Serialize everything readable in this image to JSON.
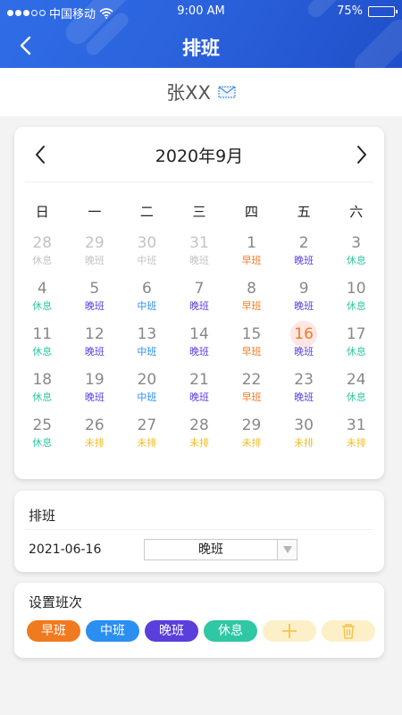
{
  "status": {
    "carrier": "中国移动",
    "time": "9:00 AM",
    "battery": "75%",
    "battery_level": 0.75
  },
  "nav": {
    "title": "排班"
  },
  "user": {
    "name": "张XX"
  },
  "calendar": {
    "month_label": "2020年9月",
    "weekdays": [
      "日",
      "一",
      "二",
      "三",
      "四",
      "五",
      "六"
    ],
    "days": [
      {
        "num": "28",
        "tag": "休息",
        "type": "rest",
        "other": true
      },
      {
        "num": "29",
        "tag": "晚班",
        "type": "night",
        "other": true
      },
      {
        "num": "30",
        "tag": "中班",
        "type": "mid",
        "other": true
      },
      {
        "num": "31",
        "tag": "晚班",
        "type": "night",
        "other": true
      },
      {
        "num": "1",
        "tag": "早班",
        "type": "early"
      },
      {
        "num": "2",
        "tag": "晚班",
        "type": "night"
      },
      {
        "num": "3",
        "tag": "休息",
        "type": "rest"
      },
      {
        "num": "4",
        "tag": "休息",
        "type": "rest"
      },
      {
        "num": "5",
        "tag": "晚班",
        "type": "night"
      },
      {
        "num": "6",
        "tag": "中班",
        "type": "mid"
      },
      {
        "num": "7",
        "tag": "晚班",
        "type": "night"
      },
      {
        "num": "8",
        "tag": "早班",
        "type": "early"
      },
      {
        "num": "9",
        "tag": "晚班",
        "type": "night"
      },
      {
        "num": "10",
        "tag": "休息",
        "type": "rest"
      },
      {
        "num": "11",
        "tag": "休息",
        "type": "rest"
      },
      {
        "num": "12",
        "tag": "晚班",
        "type": "night"
      },
      {
        "num": "13",
        "tag": "中班",
        "type": "mid"
      },
      {
        "num": "14",
        "tag": "晚班",
        "type": "night"
      },
      {
        "num": "15",
        "tag": "早班",
        "type": "early"
      },
      {
        "num": "16",
        "tag": "晚班",
        "type": "night",
        "selected": true
      },
      {
        "num": "17",
        "tag": "休息",
        "type": "rest"
      },
      {
        "num": "18",
        "tag": "休息",
        "type": "rest"
      },
      {
        "num": "19",
        "tag": "晚班",
        "type": "night"
      },
      {
        "num": "20",
        "tag": "中班",
        "type": "mid"
      },
      {
        "num": "21",
        "tag": "晚班",
        "type": "night"
      },
      {
        "num": "22",
        "tag": "早班",
        "type": "early"
      },
      {
        "num": "23",
        "tag": "晚班",
        "type": "night"
      },
      {
        "num": "24",
        "tag": "休息",
        "type": "rest"
      },
      {
        "num": "25",
        "tag": "休息",
        "type": "rest"
      },
      {
        "num": "26",
        "tag": "未排",
        "type": "none"
      },
      {
        "num": "27",
        "tag": "未排",
        "type": "none"
      },
      {
        "num": "28",
        "tag": "未排",
        "type": "none"
      },
      {
        "num": "29",
        "tag": "未排",
        "type": "none"
      },
      {
        "num": "30",
        "tag": "未排",
        "type": "none"
      },
      {
        "num": "31",
        "tag": "未排",
        "type": "none"
      }
    ]
  },
  "schedule": {
    "title": "排班",
    "date": "2021-06-16",
    "shift_value": "晚班"
  },
  "shift_settings": {
    "title": "设置班次",
    "chips": [
      {
        "label": "早班",
        "type": "early"
      },
      {
        "label": "中班",
        "type": "mid"
      },
      {
        "label": "晚班",
        "type": "night"
      },
      {
        "label": "休息",
        "type": "rest"
      }
    ],
    "add_icon": "plus-icon",
    "delete_icon": "trash-icon"
  },
  "colors": {
    "header": "#2b63dc",
    "early": "#f07a1f",
    "mid": "#2a8ff0",
    "night": "#5b3fdc",
    "rest": "#2fc7a4",
    "none": "#f1bd24",
    "other": "#c3c3c3",
    "selected_bg": "#fde6e4",
    "chip_icon_bg": "#fdf0c8",
    "chip_icon_fg": "#f3c44b"
  }
}
